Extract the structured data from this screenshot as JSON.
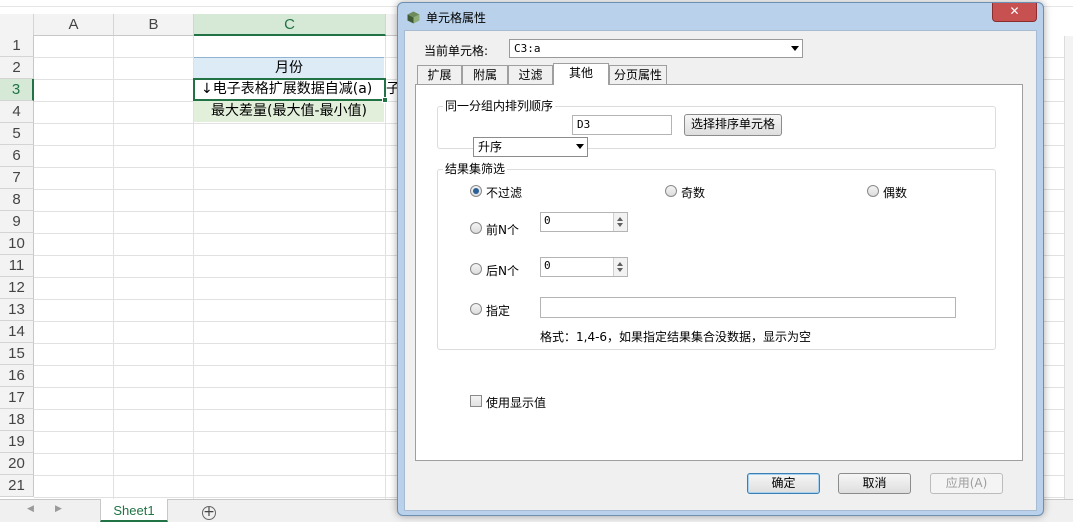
{
  "spreadsheet": {
    "columns": [
      "A",
      "B",
      "C"
    ],
    "rows": [
      "1",
      "2",
      "3",
      "4",
      "5",
      "6",
      "7",
      "8",
      "9",
      "10",
      "11",
      "12",
      "13",
      "14",
      "15",
      "16",
      "17",
      "18",
      "19",
      "20",
      "21"
    ],
    "cells": {
      "C2": "月份",
      "C3": "↓电子表格扩展数据自减(a)",
      "D3": "子",
      "C4": "最大差量(最大值-最小值)"
    },
    "sheet_tab": "Sheet1",
    "add_sheet_icon": "plus-circle-icon",
    "accent_color": "#217346"
  },
  "dialog": {
    "title": "单元格属性",
    "close_label": "✕",
    "current_cell_label": "当前单元格:",
    "current_cell_value": "C3:a",
    "tabs": [
      "扩展",
      "附属",
      "过滤",
      "其他",
      "分页属性"
    ],
    "active_tab": "其他",
    "sort_group": {
      "title": "同一分组内排列顺序",
      "order_value": "升序",
      "cell_value": "D3",
      "select_button": "选择排序单元格"
    },
    "filter_group": {
      "title": "结果集筛选",
      "options": {
        "no_filter": "不过滤",
        "odd": "奇数",
        "even": "偶数",
        "first_n": "前N个",
        "last_n": "后N个",
        "specify": "指定"
      },
      "selected": "no_filter",
      "first_n_value": "0",
      "last_n_value": "0",
      "specify_value": "",
      "format_hint": "格式：1,4-6，如果指定结果集合没数据，显示为空"
    },
    "use_display_value": "使用显示值",
    "use_display_value_checked": false,
    "buttons": {
      "ok": "确定",
      "cancel": "取消",
      "apply": "应用(A)"
    }
  }
}
